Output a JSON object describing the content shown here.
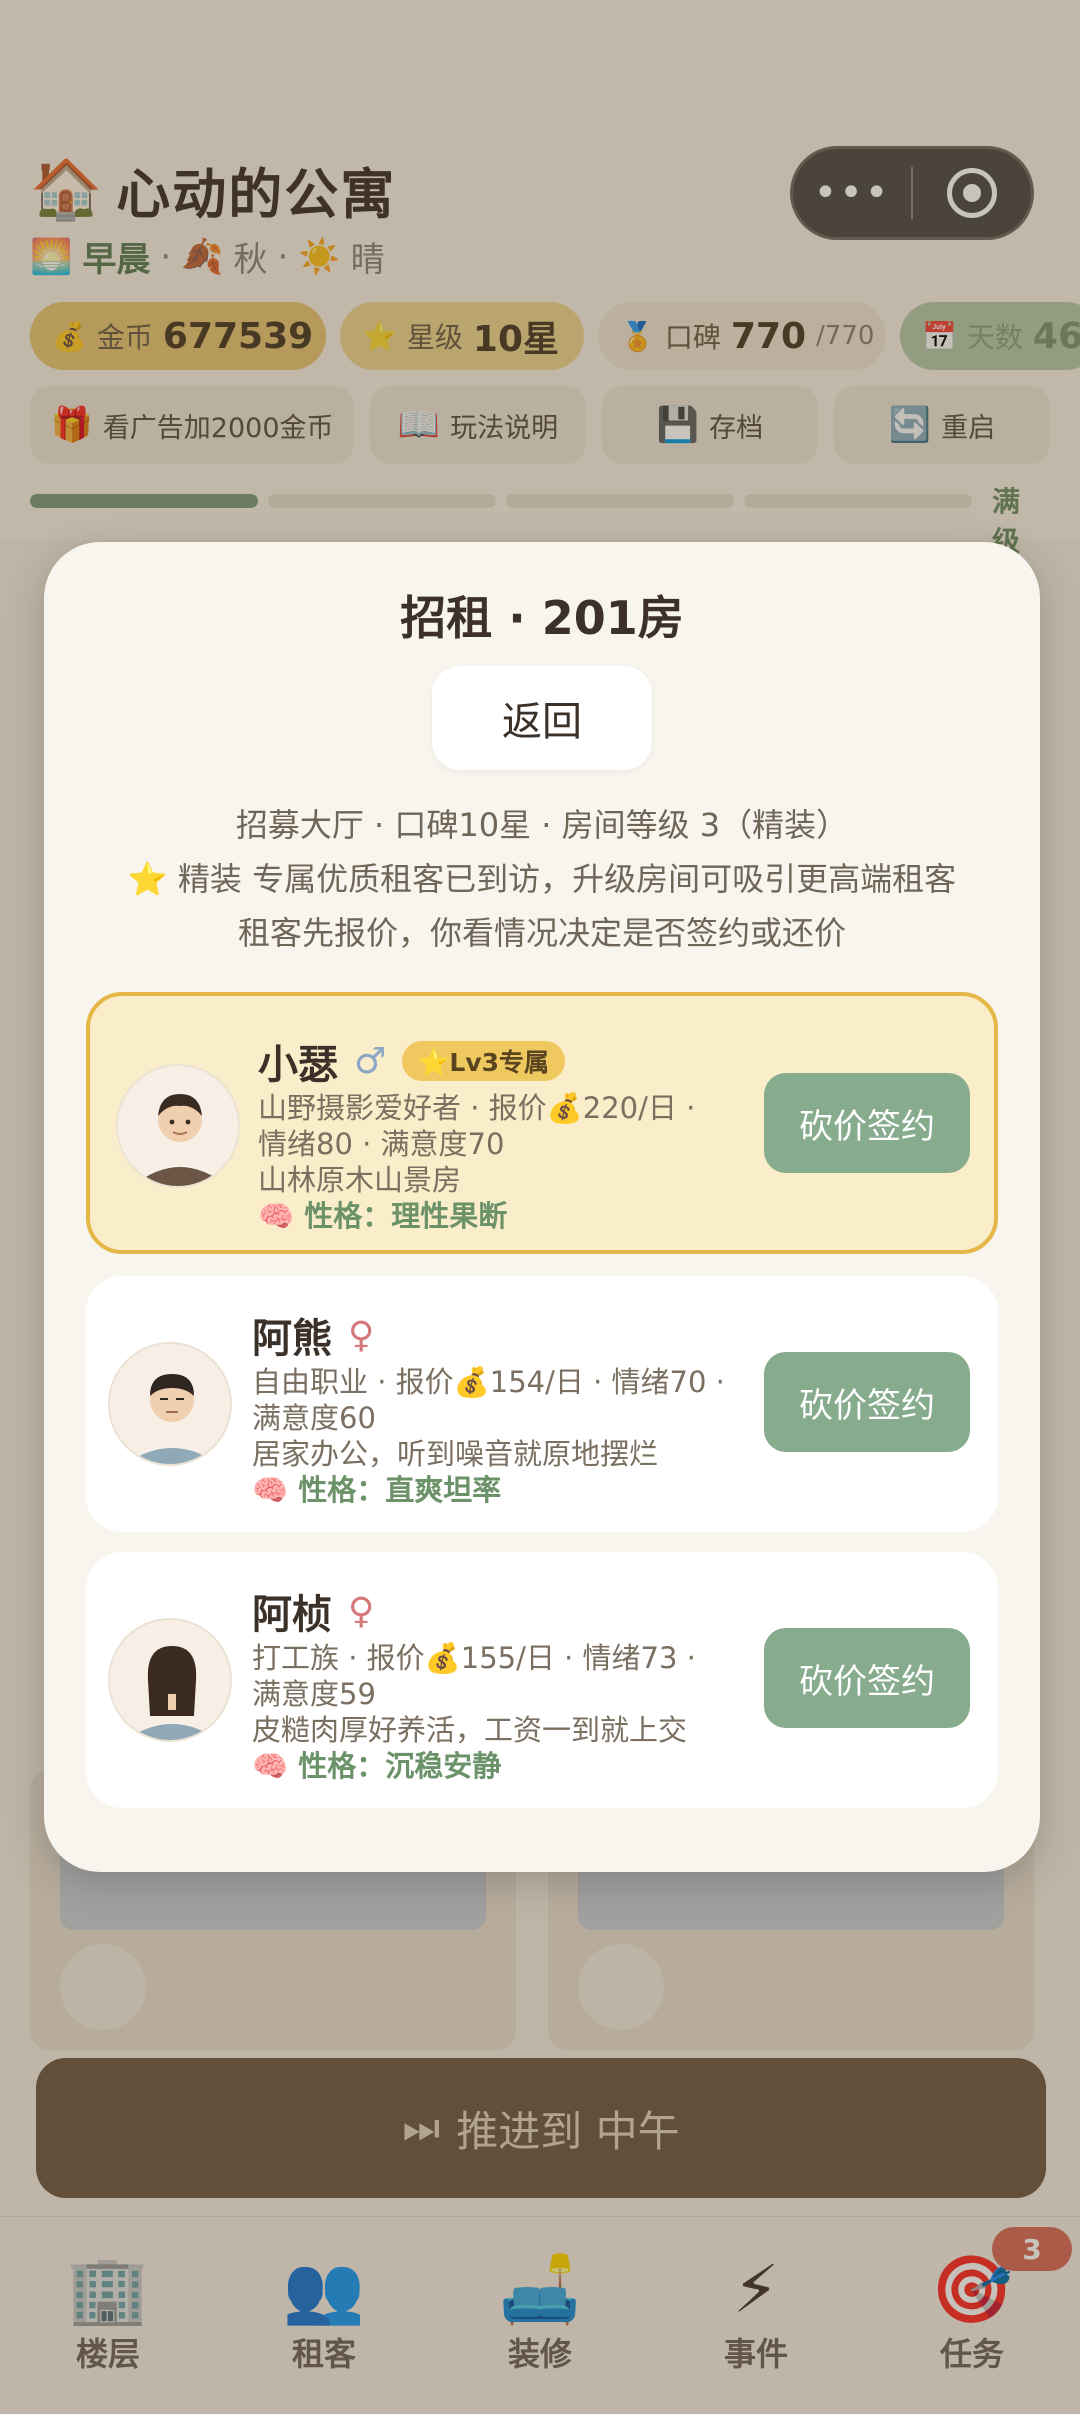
{
  "app": {
    "title": "心动的公寓",
    "title_icon": "🏠",
    "time_of_day": "早晨",
    "time_icon": "🌅",
    "season": "秋",
    "season_icon": "🍂",
    "weather": "晴",
    "weather_icon": "☀️"
  },
  "capsule": {
    "more": "•••"
  },
  "stats": {
    "gold_label": "金币",
    "gold_value": "677539",
    "gold_icon": "💰",
    "star_label": "星级",
    "star_value": "10星",
    "star_icon": "⭐",
    "rep_label": "口碑",
    "rep_value": "770",
    "rep_max": "/770",
    "rep_icon": "🏅",
    "days_label": "天数",
    "days_value": "46",
    "days_icon": "📅"
  },
  "actions": [
    {
      "icon": "🎁",
      "label": "看广告加2000金币"
    },
    {
      "icon": "📖",
      "label": "玩法说明"
    },
    {
      "icon": "💾",
      "label": "存档"
    },
    {
      "icon": "🔄",
      "label": "重启"
    }
  ],
  "level_status": "满级",
  "advance_button": {
    "icon": "⏭",
    "label": "推进到 中午"
  },
  "tabs": [
    {
      "icon": "🏢",
      "label": "楼层"
    },
    {
      "icon": "👥",
      "label": "租客"
    },
    {
      "icon": "🛋️",
      "label": "装修"
    },
    {
      "icon": "⚡",
      "label": "事件"
    },
    {
      "icon": "🎯",
      "label": "任务",
      "badge": "3"
    }
  ],
  "modal": {
    "title": "招租 · 201房",
    "back_label": "返回",
    "info_line1": "招募大厅 · 口碑10星 · 房间等级 3（精装）",
    "info_line2": "⭐ 精装 专属优质租客已到访，升级房间可吸引更高端租客",
    "info_line3": "租客先报价，你看情况决定是否签约或还价",
    "tenants": [
      {
        "name": "小瑟",
        "gender": "♂",
        "tag": "⭐Lv3专属",
        "line1": "山野摄影爱好者 · 报价💰220/日 ·",
        "line2": "情绪80 · 满意度70",
        "line3": "山林原木山景房",
        "personality": "🧠 性格：理性果断",
        "button": "砍价签约"
      },
      {
        "name": "阿熊",
        "gender": "♀",
        "line1": "自由职业 · 报价💰154/日 · 情绪70 ·",
        "line2": "满意度60",
        "line3": "居家办公，听到噪音就原地摆烂",
        "personality": "🧠 性格：直爽坦率",
        "button": "砍价签约"
      },
      {
        "name": "阿桢",
        "gender": "♀",
        "line1": "打工族 · 报价💰155/日 · 情绪73 ·",
        "line2": "满意度59",
        "line3": "皮糙肉厚好养活，工资一到就上交",
        "personality": "🧠 性格：沉稳安静",
        "button": "砍价签约"
      }
    ]
  }
}
